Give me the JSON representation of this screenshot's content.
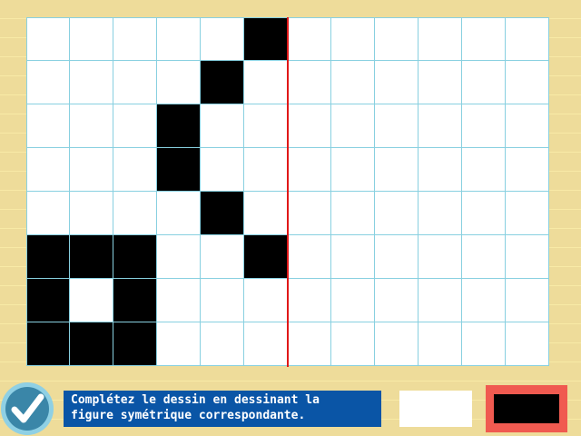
{
  "instruction": {
    "line1": "Complétez le dessin en dessinant la",
    "line2": "figure symétrique correspondante."
  },
  "grid": {
    "columns": 12,
    "rows": 8,
    "cells": [
      [
        0,
        0,
        0,
        0,
        0,
        1,
        0,
        0,
        0,
        0,
        0,
        0
      ],
      [
        0,
        0,
        0,
        0,
        1,
        0,
        0,
        0,
        0,
        0,
        0,
        0
      ],
      [
        0,
        0,
        0,
        1,
        0,
        0,
        0,
        0,
        0,
        0,
        0,
        0
      ],
      [
        0,
        0,
        0,
        1,
        0,
        0,
        0,
        0,
        0,
        0,
        0,
        0
      ],
      [
        0,
        0,
        0,
        0,
        1,
        0,
        0,
        0,
        0,
        0,
        0,
        0
      ],
      [
        1,
        1,
        1,
        0,
        0,
        1,
        0,
        0,
        0,
        0,
        0,
        0
      ],
      [
        1,
        0,
        1,
        0,
        0,
        0,
        0,
        0,
        0,
        0,
        0,
        0
      ],
      [
        1,
        1,
        1,
        0,
        0,
        0,
        0,
        0,
        0,
        0,
        0,
        0
      ]
    ]
  },
  "palette": {
    "white": "#ffffff",
    "black": "#000000",
    "selected": "black",
    "selected_border": "#f05a50"
  },
  "colors": {
    "background": "#eedc9a",
    "grid_line": "#88d0e0",
    "axis": "#e01818",
    "instruction_bg": "#0a55a6",
    "check_outer": "#8fd0e4",
    "check_inner": "#3a86a8"
  },
  "icons": {
    "check": "checkmark-icon"
  }
}
